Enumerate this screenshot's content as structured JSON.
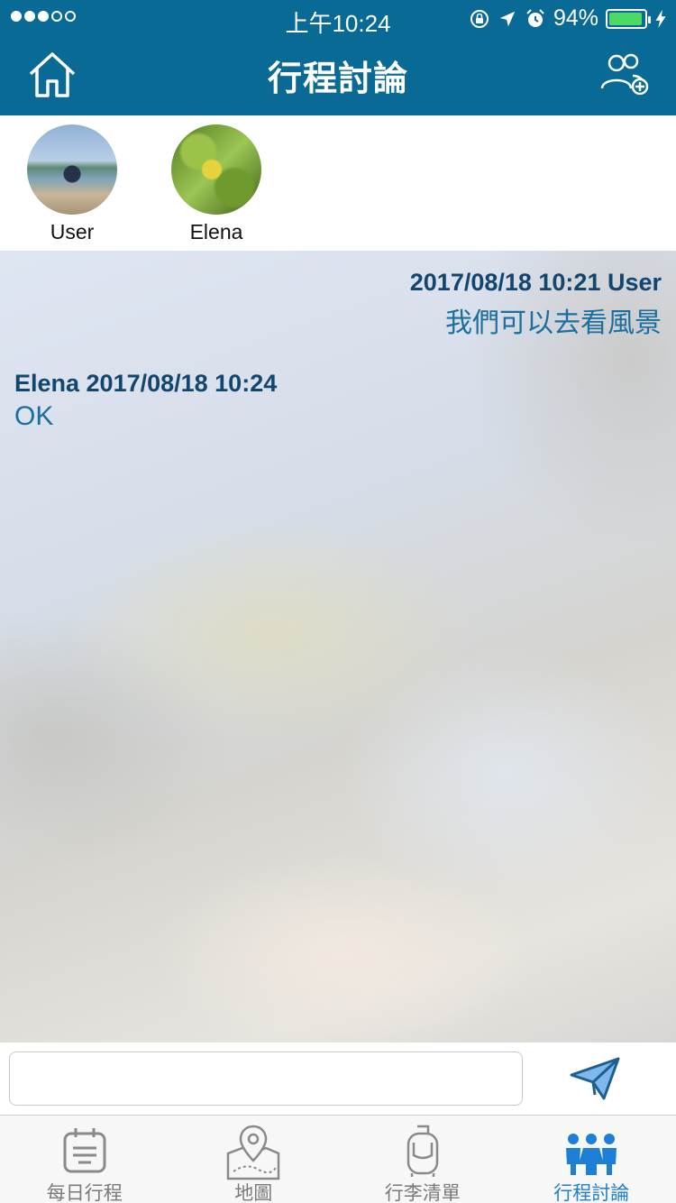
{
  "status_bar": {
    "time": "上午10:24",
    "battery": "94%",
    "battery_level": 0.94
  },
  "header": {
    "title": "行程討論",
    "home_icon": "home-icon",
    "add_member_icon": "add-user-icon"
  },
  "members": [
    {
      "name": "User"
    },
    {
      "name": "Elena"
    }
  ],
  "messages": [
    {
      "meta": "2017/08/18 10:21 User",
      "text": "我們可以去看風景",
      "align": "right"
    },
    {
      "meta": "Elena 2017/08/18 10:24",
      "text": "OK",
      "align": "left"
    }
  ],
  "composer": {
    "value": "",
    "send_icon": "send-icon"
  },
  "tabs": [
    {
      "label": "每日行程",
      "icon": "calendar-icon",
      "active": false
    },
    {
      "label": "地圖",
      "icon": "map-icon",
      "active": false
    },
    {
      "label": "行李清單",
      "icon": "luggage-icon",
      "active": false
    },
    {
      "label": "行程討論",
      "icon": "group-icon",
      "active": true
    }
  ],
  "colors": {
    "header_bg": "#0a6a96",
    "active_tab": "#1e7fd6",
    "message_meta": "#13466e",
    "message_text": "#1a6f9f"
  }
}
